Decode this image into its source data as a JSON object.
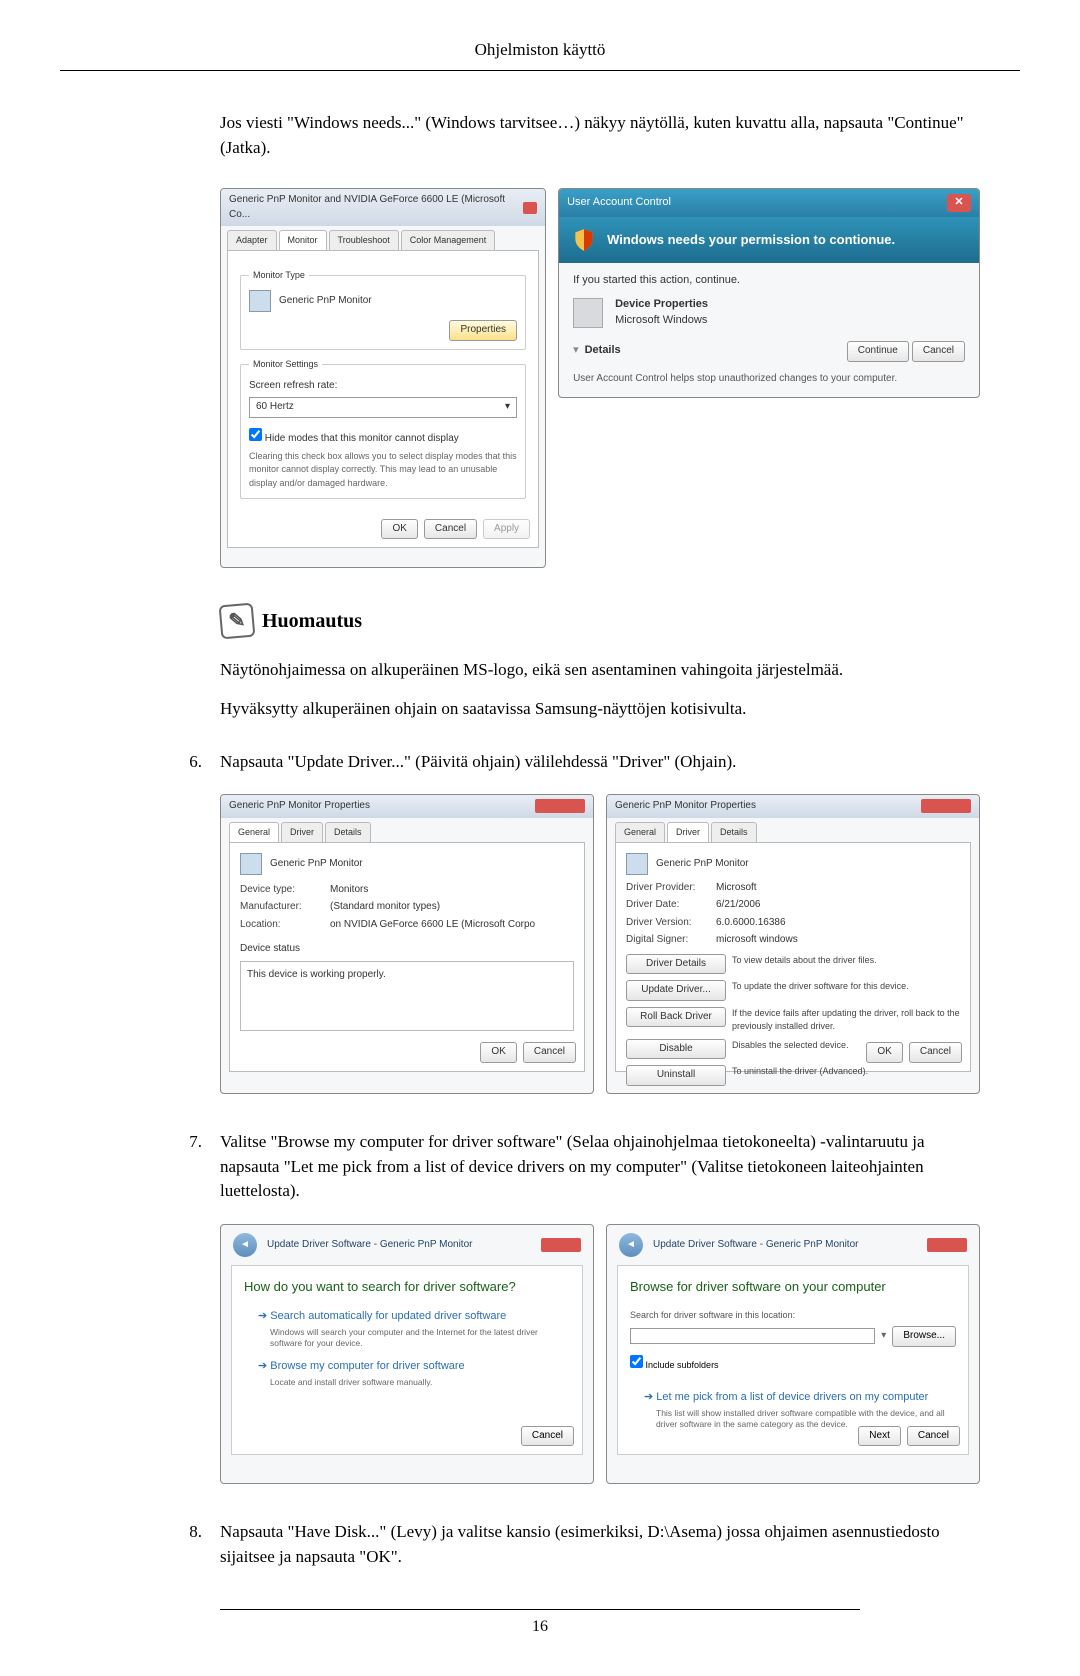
{
  "header": {
    "title": "Ohjelmiston käyttö"
  },
  "intro": "Jos viesti \"Windows needs...\" (Windows tarvitsee…) näkyy näytöllä, kuten kuvattu alla, napsauta \"Continue\" (Jatka).",
  "fig1": {
    "a": {
      "title": "Generic PnP Monitor and NVIDIA GeForce 6600 LE (Microsoft Co...",
      "tabs": [
        "Adapter",
        "Monitor",
        "Troubleshoot",
        "Color Management"
      ],
      "section_type": "Monitor Type",
      "monitor_name": "Generic PnP Monitor",
      "properties_btn": "Properties",
      "section_settings": "Monitor Settings",
      "refresh_label": "Screen refresh rate:",
      "refresh_value": "60 Hertz",
      "hide_modes": "Hide modes that this monitor cannot display",
      "hide_modes_desc": "Clearing this check box allows you to select display modes that this monitor cannot display correctly. This may lead to an unusable display and/or damaged hardware.",
      "ok": "OK",
      "cancel": "Cancel",
      "apply": "Apply"
    },
    "b": {
      "title": "User Account Control",
      "banner": "Windows needs your permission to contionue.",
      "if_started": "If you started this action, continue.",
      "prog_name": "Device Properties",
      "prog_pub": "Microsoft Windows",
      "details": "Details",
      "continue": "Continue",
      "cancel": "Cancel",
      "foot": "User Account Control helps stop unauthorized changes to your computer."
    }
  },
  "note": {
    "title": "Huomautus",
    "p1": "Näytönohjaimessa on alkuperäinen MS-logo, eikä sen asentaminen vahingoita järjestelmää.",
    "p2": "Hyväksytty alkuperäinen ohjain on saatavissa Samsung-näyttöjen kotisivulta."
  },
  "step6": {
    "num": "6.",
    "text": "Napsauta \"Update Driver...\" (Päivitä ohjain) välilehdessä \"Driver\" (Ohjain)."
  },
  "fig2": {
    "c": {
      "title": "Generic PnP Monitor Properties",
      "tabs": [
        "General",
        "Driver",
        "Details"
      ],
      "dev_name": "Generic PnP Monitor",
      "kv": [
        {
          "k": "Device type:",
          "v": "Monitors"
        },
        {
          "k": "Manufacturer:",
          "v": "(Standard monitor types)"
        },
        {
          "k": "Location:",
          "v": "on NVIDIA GeForce 6600 LE (Microsoft Corpo"
        }
      ],
      "status_label": "Device status",
      "status": "This device is working properly.",
      "ok": "OK",
      "cancel": "Cancel"
    },
    "d": {
      "title": "Generic PnP Monitor Properties",
      "tabs": [
        "General",
        "Driver",
        "Details"
      ],
      "dev_name": "Generic PnP Monitor",
      "kv": [
        {
          "k": "Driver Provider:",
          "v": "Microsoft"
        },
        {
          "k": "Driver Date:",
          "v": "6/21/2006"
        },
        {
          "k": "Driver Version:",
          "v": "6.0.6000.16386"
        },
        {
          "k": "Digital Signer:",
          "v": "microsoft windows"
        }
      ],
      "btns": [
        {
          "b": "Driver Details",
          "d": "To view details about the driver files."
        },
        {
          "b": "Update Driver...",
          "d": "To update the driver software for this device."
        },
        {
          "b": "Roll Back Driver",
          "d": "If the device fails after updating the driver, roll back to the previously installed driver."
        },
        {
          "b": "Disable",
          "d": "Disables the selected device."
        },
        {
          "b": "Uninstall",
          "d": "To uninstall the driver (Advanced)."
        }
      ],
      "ok": "OK",
      "cancel": "Cancel"
    }
  },
  "step7": {
    "num": "7.",
    "text": "Valitse \"Browse my computer for driver software\" (Selaa ohjainohjelmaa tietokoneelta) -valintaruutu ja napsauta \"Let me pick from a list of device drivers on my computer\" (Valitse tietokoneen laiteohjainten luettelosta)."
  },
  "fig3": {
    "e": {
      "crumb": "Update Driver Software - Generic PnP Monitor",
      "h": "How do you want to search for driver software?",
      "opt1": "Search automatically for updated driver software",
      "opt1d": "Windows will search your computer and the Internet for the latest driver software for your device.",
      "opt2": "Browse my computer for driver software",
      "opt2d": "Locate and install driver software manually.",
      "cancel": "Cancel"
    },
    "f": {
      "crumb": "Update Driver Software - Generic PnP Monitor",
      "h": "Browse for driver software on your computer",
      "loc_label": "Search for driver software in this location:",
      "browse": "Browse...",
      "sub": "Include subfolders",
      "opt": "Let me pick from a list of device drivers on my computer",
      "optd": "This list will show installed driver software compatible with the device, and all driver software in the same category as the device.",
      "next": "Next",
      "cancel": "Cancel"
    }
  },
  "step8": {
    "num": "8.",
    "text": "Napsauta \"Have Disk...\" (Levy) ja valitse kansio (esimerkiksi, D:\\Asema) jossa ohjaimen asennustiedosto sijaitsee ja napsauta \"OK\"."
  },
  "page_number": "16"
}
